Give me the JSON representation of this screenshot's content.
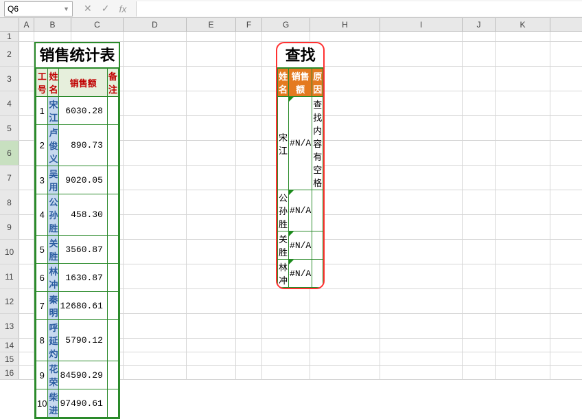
{
  "formula_bar": {
    "name_box": "Q6",
    "cancel_icon": "✕",
    "confirm_icon": "✓",
    "fx_label": "fx",
    "value": ""
  },
  "columns": [
    "A",
    "B",
    "C",
    "D",
    "E",
    "F",
    "G",
    "H",
    "I",
    "J",
    "K"
  ],
  "row_numbers": [
    "1",
    "2",
    "3",
    "4",
    "5",
    "6",
    "7",
    "8",
    "9",
    "10",
    "11",
    "12",
    "13",
    "14",
    "15",
    "16"
  ],
  "selected_row": "6",
  "left_table": {
    "title": "销售统计表",
    "headers": {
      "id": "工号",
      "name": "姓名",
      "sales": "销售额",
      "remark": "备注"
    },
    "rows": [
      {
        "id": "1",
        "name": "宋江",
        "sales": "6030.28",
        "remark": ""
      },
      {
        "id": "2",
        "name": "卢俊义",
        "sales": "890.73",
        "remark": ""
      },
      {
        "id": "3",
        "name": "吴用",
        "sales": "9020.05",
        "remark": ""
      },
      {
        "id": "4",
        "name": "公孙胜",
        "sales": "458.30",
        "remark": ""
      },
      {
        "id": "5",
        "name": "关胜",
        "sales": "3560.87",
        "remark": ""
      },
      {
        "id": "6",
        "name": "林冲",
        "sales": "1630.87",
        "remark": ""
      },
      {
        "id": "7",
        "name": "秦明",
        "sales": "12680.61",
        "remark": ""
      },
      {
        "id": "8",
        "name": "呼延灼",
        "sales": "5790.12",
        "remark": ""
      },
      {
        "id": "9",
        "name": "花荣",
        "sales": "84590.29",
        "remark": ""
      },
      {
        "id": "10",
        "name": "柴进",
        "sales": "97490.61",
        "remark": ""
      }
    ]
  },
  "right_table": {
    "title": "查找",
    "headers": {
      "name": "姓名",
      "sales": "销售额",
      "reason": "原因"
    },
    "rows": [
      {
        "name": "宋江",
        "sales": "#N/A",
        "reason": "查找内容有空格"
      },
      {
        "name": "公孙胜",
        "sales": "#N/A",
        "reason": ""
      },
      {
        "name": "关胜",
        "sales": "#N/A",
        "reason": ""
      },
      {
        "name": "林冲",
        "sales": "#N/A",
        "reason": ""
      }
    ]
  }
}
